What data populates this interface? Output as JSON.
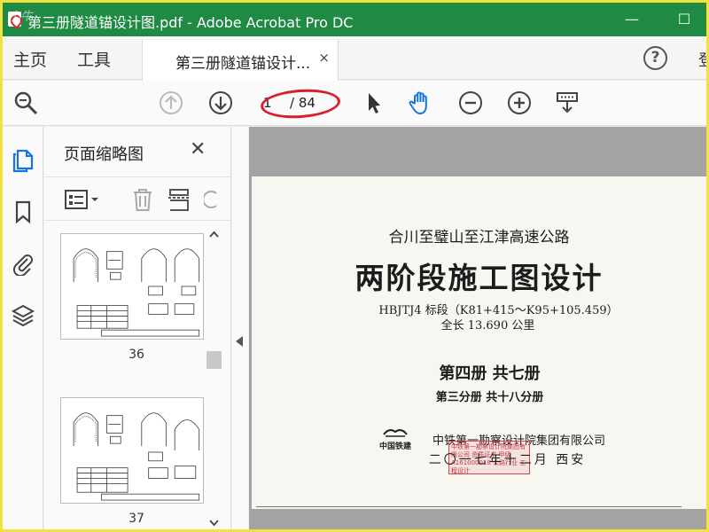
{
  "window": {
    "title": "第三册隧道锚设计图.pdf - Adobe Acrobat Pro DC",
    "watermark": "小牛",
    "minimize": "—",
    "maximize": "☐"
  },
  "menu": {
    "home": "主页",
    "tools": "工具",
    "doc_tab": "第三册隧道锚设计...",
    "doc_tab_close": "×",
    "help": "?",
    "signin": "登"
  },
  "toolbar": {
    "current_page": "1",
    "total_pages": "/ 84",
    "highlight_color": "#d8202c"
  },
  "panel": {
    "title": "页面缩略图",
    "close": "✕",
    "thumbnails": [
      {
        "page": "36"
      },
      {
        "page": "37"
      }
    ]
  },
  "document": {
    "line1": "合川至璧山至江津高速公路",
    "line2": "两阶段施工图设计",
    "line3": "HBJTJ4 标段（K81+415～K95+105.459）",
    "line4": "全长 13.690 公里",
    "line5": "第四册  共七册",
    "line6": "第三分册    共十八分册",
    "line7": "中铁第一勘察设计院集团有限公司",
    "line8": "二〇一七年十二月  西安",
    "logo_text": "中国铁建",
    "stamp_text": "中铁第一勘察设计院集团有限公司 资质证书 甲级 A161000018 公路行业 工程设计"
  },
  "colors": {
    "titlebar": "#1e8a43",
    "frame": "#f4e23c",
    "accent": "#1473e6"
  }
}
